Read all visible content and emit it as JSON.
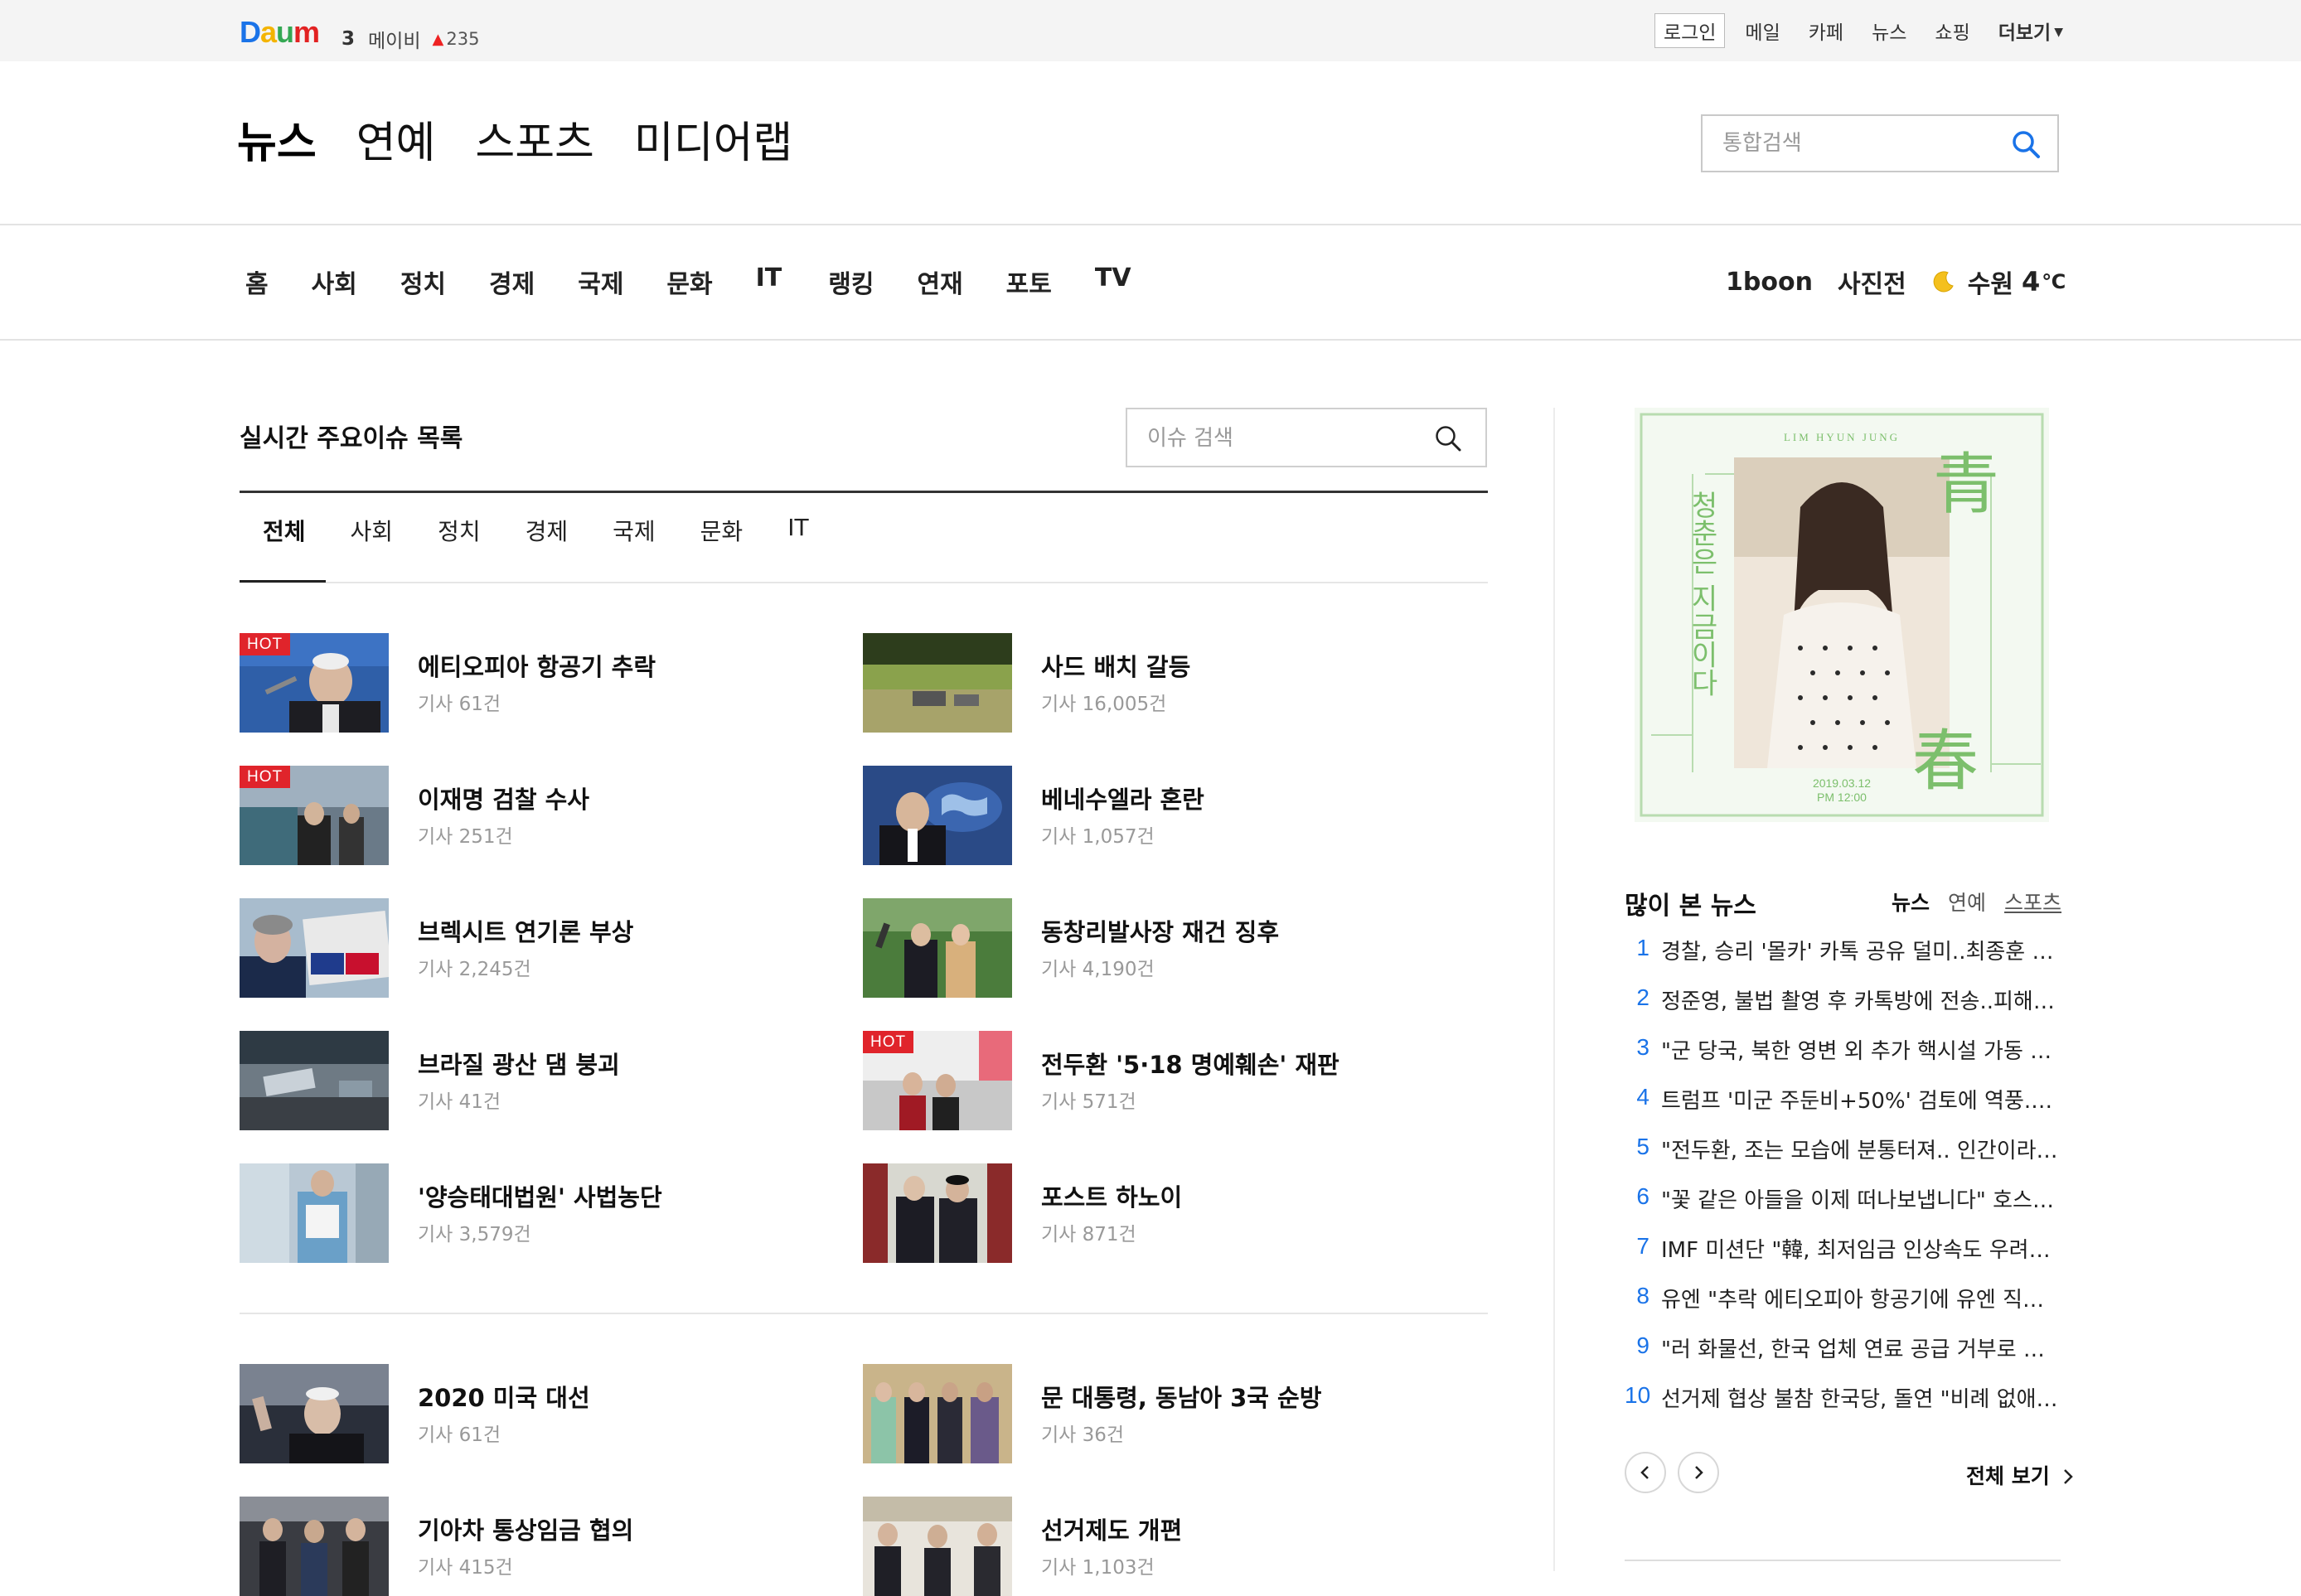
{
  "topbar": {
    "logo": [
      "D",
      "a",
      "u",
      "m"
    ],
    "logo_colors": [
      "#1a73e8",
      "#f4b400",
      "#34a853",
      "#e22222"
    ],
    "trend_rank": "3",
    "trend_keyword": "메이비",
    "trend_delta": "235",
    "login": "로그인",
    "links": [
      "메일",
      "카페",
      "뉴스",
      "쇼핑"
    ],
    "more": "더보기"
  },
  "header": {
    "gnb": [
      "뉴스",
      "연예",
      "스포츠",
      "미디어랩"
    ],
    "search_placeholder": "통합검색"
  },
  "snb": {
    "items": [
      "홈",
      "사회",
      "정치",
      "경제",
      "국제",
      "문화",
      "IT",
      "랭킹",
      "연재",
      "포토",
      "TV"
    ],
    "right": [
      "1boon",
      "사진전"
    ],
    "weather_city": "수원",
    "weather_temp": "4",
    "weather_unit": "℃"
  },
  "issues": {
    "title": "실시간 주요이슈 목록",
    "search_placeholder": "이슈 검색",
    "tabs": [
      "전체",
      "사회",
      "정치",
      "경제",
      "국제",
      "문화",
      "IT"
    ],
    "hot_label": "HOT",
    "items": [
      {
        "title": "에티오피아 항공기 추락",
        "count": "기사 61건",
        "hot": true
      },
      {
        "title": "사드 배치 갈등",
        "count": "기사 16,005건",
        "hot": false
      },
      {
        "title": "이재명 검찰 수사",
        "count": "기사 251건",
        "hot": true
      },
      {
        "title": "베네수엘라 혼란",
        "count": "기사 1,057건",
        "hot": false
      },
      {
        "title": "브렉시트 연기론 부상",
        "count": "기사 2,245건",
        "hot": false
      },
      {
        "title": "동창리발사장 재건 징후",
        "count": "기사 4,190건",
        "hot": false
      },
      {
        "title": "브라질 광산 댐 붕괴",
        "count": "기사 41건",
        "hot": false
      },
      {
        "title": "전두환 '5·18 명예훼손' 재판",
        "count": "기사 571건",
        "hot": true
      },
      {
        "title": "'양승태대법원' 사법농단",
        "count": "기사 3,579건",
        "hot": false
      },
      {
        "title": "포스트 하노이",
        "count": "기사 871건",
        "hot": false
      }
    ],
    "items2": [
      {
        "title": "2020 미국 대선",
        "count": "기사 61건"
      },
      {
        "title": "문 대통령, 동남아 3국 순방",
        "count": "기사 36건"
      },
      {
        "title": "기아차 통상임금 협의",
        "count": "기사 415건"
      },
      {
        "title": "선거제도 개편",
        "count": "기사 1,103건"
      }
    ]
  },
  "banner": {
    "artist": "LIM HYUN JUNG",
    "vertical_text": "청춘은 지금이다",
    "han1": "青",
    "han2": "春",
    "date": "2019.03.12",
    "time": "PM 12:00"
  },
  "popular": {
    "title": "많이 본 뉴스",
    "tabs": [
      "뉴스",
      "연예",
      "스포츠"
    ],
    "items": [
      "경찰, 승리 '몰카' 카톡 공유 덜미..최종훈 …",
      "정준영, 불법 촬영 후 카톡방에 전송..피해…",
      "\"군 당국, 북한 영변 외 추가 핵시설 가동 …",
      "트럼프 '미군 주둔비+50%' 검토에 역풍..\"…",
      "\"전두환, 조는 모습에 분통터져.. 인간이라…",
      "\"꽃 같은 아들을 이제 떠나보냅니다\" 호스…",
      "IMF 미션단 \"韓, 최저임금 인상속도 우려…",
      "유엔 \"추락 에티오피아 항공기에 유엔 직…",
      "\"러 화물선, 한국 업체 연료 공급 거부로 …",
      "선거제 협상 불참 한국당, 돌연 \"비례 없애…"
    ],
    "view_all": "전체 보기"
  }
}
